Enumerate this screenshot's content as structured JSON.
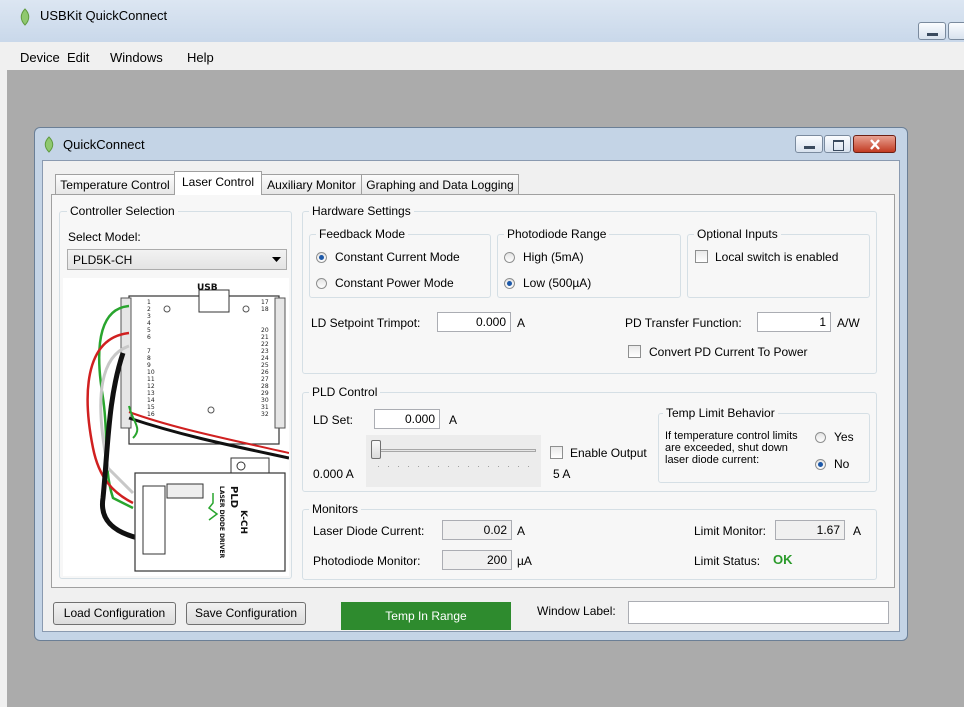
{
  "app": {
    "title": "USBKit QuickConnect",
    "menu": [
      "Device",
      "Edit",
      "Windows",
      "Help"
    ]
  },
  "window": {
    "title": "QuickConnect"
  },
  "tabs": [
    "Temperature Control",
    "Laser Control",
    "Auxiliary Monitor",
    "Graphing and Data Logging"
  ],
  "controller": {
    "group": "Controller Selection",
    "select_label": "Select Model:",
    "model": "PLD5K-CH",
    "board_labels": [
      "USB",
      "PLD",
      "LASER DIODE DRIVER",
      "K-CH"
    ]
  },
  "hardware": {
    "group": "Hardware Settings",
    "feedback": {
      "group": "Feedback Mode",
      "options": [
        "Constant Current Mode",
        "Constant Power Mode"
      ],
      "selected": 0
    },
    "photodiode": {
      "group": "Photodiode Range",
      "options": [
        "High (5mA)",
        "Low (500µA)"
      ],
      "selected": 1
    },
    "optional": {
      "group": "Optional Inputs",
      "local_switch": "Local switch is enabled"
    },
    "ld_setpoint_label": "LD Setpoint Trimpot:",
    "ld_setpoint_value": "0.000",
    "ld_setpoint_unit": "A",
    "pd_transfer_label": "PD Transfer Function:",
    "pd_transfer_value": "1",
    "pd_transfer_unit": "A/W",
    "convert_pd": "Convert PD Current To Power"
  },
  "pld": {
    "group": "PLD Control",
    "ld_set_label": "LD Set:",
    "ld_set_value": "0.000",
    "ld_set_unit": "A",
    "slider_min": "0.000 A",
    "slider_max": "5 A",
    "slider_level": 0,
    "enable_output": "Enable Output",
    "temp_limit": {
      "group": "Temp Limit Behavior",
      "text": "If temperature control limits are exceeded, shut down laser diode current:",
      "options": [
        "Yes",
        "No"
      ],
      "selected": 1
    }
  },
  "monitors": {
    "group": "Monitors",
    "ld_current_label": "Laser Diode Current:",
    "ld_current_value": "0.02",
    "ld_current_unit": "A",
    "pd_monitor_label": "Photodiode Monitor:",
    "pd_monitor_value": "200",
    "pd_monitor_unit": "µA",
    "limit_monitor_label": "Limit Monitor:",
    "limit_monitor_value": "1.67",
    "limit_monitor_unit": "A",
    "limit_status_label": "Limit Status:",
    "limit_status_value": "OK"
  },
  "footer": {
    "load": "Load Configuration",
    "save": "Save Configuration",
    "status": "Temp In Range",
    "window_label": "Window Label:",
    "window_label_value": ""
  },
  "colors": {
    "status_green": "#2e8b2e",
    "ok_green": "#2a9a2a",
    "accent_blue": "#1c58a8"
  }
}
